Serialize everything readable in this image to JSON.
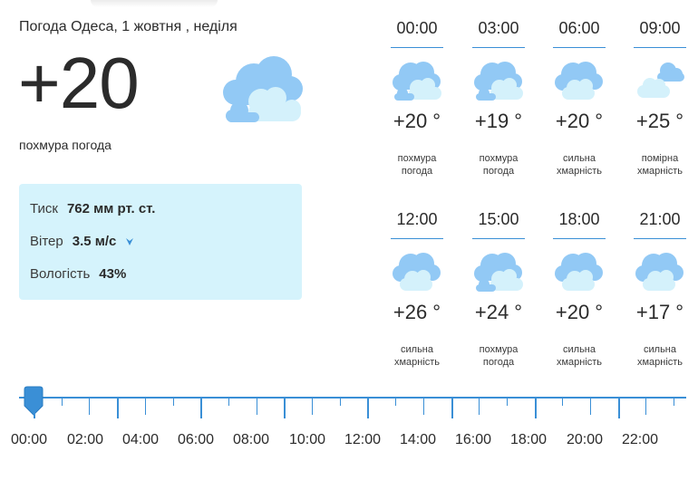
{
  "header": {
    "title": "Погода Одеса, 1 жовтня , неділя"
  },
  "current": {
    "temperature": "+20",
    "condition": "похмура погода",
    "icon": "overcast-clouds-icon"
  },
  "details": {
    "pressure": {
      "label": "Тиск",
      "value": "762 мм рт. ст."
    },
    "wind": {
      "label": "Вітер",
      "value": "3.5 м/с",
      "icon": "wind-direction-arrow-icon"
    },
    "humidity": {
      "label": "Вологість",
      "value": "43%"
    }
  },
  "hourly": [
    {
      "time": "00:00",
      "temp": "+20 °",
      "desc": "похмура погода",
      "icon": "overcast-clouds-icon"
    },
    {
      "time": "03:00",
      "temp": "+19 °",
      "desc": "похмура погода",
      "icon": "overcast-clouds-icon"
    },
    {
      "time": "06:00",
      "temp": "+20 °",
      "desc": "сильна хмарність",
      "icon": "heavy-clouds-icon"
    },
    {
      "time": "09:00",
      "temp": "+25 °",
      "desc": "помірна хмарність",
      "icon": "moderate-clouds-icon"
    },
    {
      "time": "12:00",
      "temp": "+26 °",
      "desc": "сильна хмарність",
      "icon": "heavy-clouds-icon"
    },
    {
      "time": "15:00",
      "temp": "+24 °",
      "desc": "похмура погода",
      "icon": "overcast-clouds-icon"
    },
    {
      "time": "18:00",
      "temp": "+20 °",
      "desc": "сильна хмарність",
      "icon": "heavy-clouds-icon"
    },
    {
      "time": "21:00",
      "temp": "+17 °",
      "desc": "сильна хмарність",
      "icon": "heavy-clouds-icon"
    }
  ],
  "timeline": {
    "labels": [
      "00:00",
      "02:00",
      "04:00",
      "06:00",
      "08:00",
      "10:00",
      "12:00",
      "14:00",
      "16:00",
      "18:00",
      "20:00",
      "22:00"
    ],
    "selected": "00:00"
  },
  "colors": {
    "accent": "#3a8fd6",
    "panel": "#d5f3fc",
    "cloud_light": "#d4f1fb",
    "cloud_blue": "#92c9f5"
  }
}
